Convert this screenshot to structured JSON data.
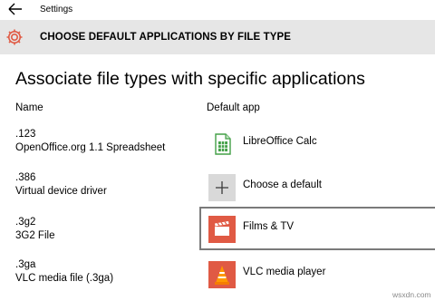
{
  "window": {
    "title": "Settings"
  },
  "header": {
    "title": "CHOOSE DEFAULT APPLICATIONS BY FILE TYPE"
  },
  "page": {
    "title": "Associate file types with specific applications",
    "columns": {
      "name": "Name",
      "app": "Default app"
    }
  },
  "rows": [
    {
      "ext": ".123",
      "desc": "OpenOffice.org 1.1 Spreadsheet",
      "app": "LibreOffice Calc",
      "icon": "libreoffice-calc-icon"
    },
    {
      "ext": ".386",
      "desc": "Virtual device driver",
      "app": "Choose a default",
      "icon": "plus-icon"
    },
    {
      "ext": ".3g2",
      "desc": "3G2 File",
      "app": "Films & TV",
      "icon": "films-tv-icon",
      "selected": true
    },
    {
      "ext": ".3ga",
      "desc": "VLC media file (.3ga)",
      "app": "VLC media player",
      "icon": "vlc-icon"
    }
  ],
  "watermark": "wsxdn.com",
  "colors": {
    "accent": "#e05a44",
    "header_bg": "#e6e6e6",
    "plus_tile": "#d9d9d9",
    "calc_green": "#43a047"
  }
}
